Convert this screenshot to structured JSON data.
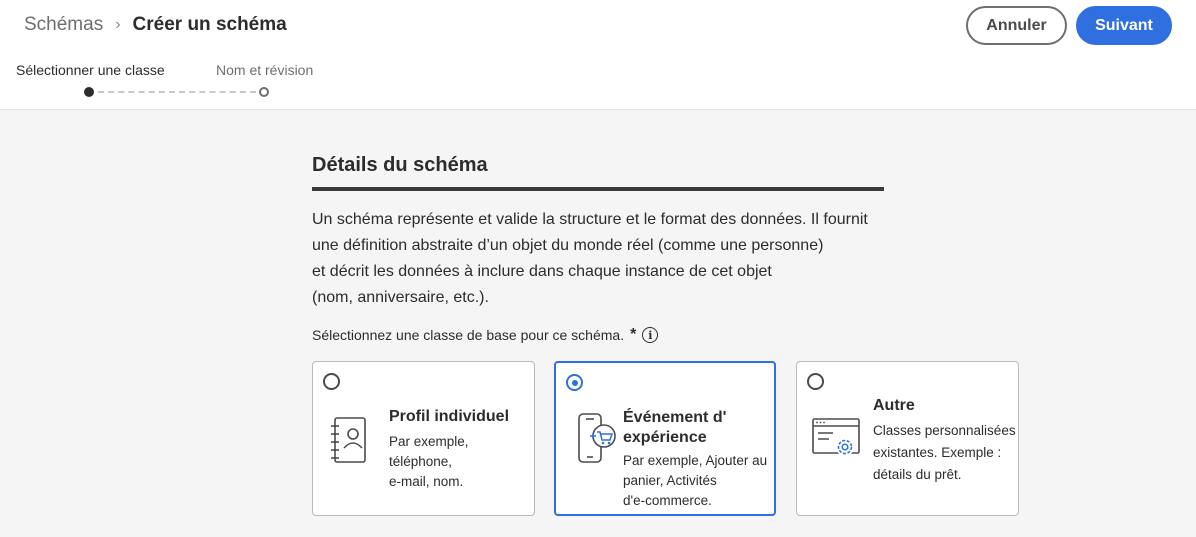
{
  "breadcrumb": {
    "parent": "Schémas",
    "separator": "›",
    "current": "Créer un schéma"
  },
  "actions": {
    "cancel_label": "Annuler",
    "next_label": "Suivant"
  },
  "steps": [
    {
      "label": "Sélectionner une classe",
      "state": "active"
    },
    {
      "label": "Nom et révision",
      "state": "pending"
    }
  ],
  "section": {
    "title": "Détails du schéma",
    "description_lines": [
      "Un schéma représente et valide la structure et le format des données. Il fournit",
      "une définition abstraite d’un objet du monde  réel (comme une personne)",
      "et décrit les données à inclure dans chaque instance de cet objet",
      "(nom, anniversaire, etc.)."
    ],
    "class_prompt": "Sélectionnez une classe de base pour ce schéma.",
    "required_marker": "*",
    "info_symbol": "i"
  },
  "classes": [
    {
      "title_lines": [
        "Profil individuel"
      ],
      "desc_lines": [
        "Par exemple,",
        "téléphone,",
        "e-mail, nom."
      ],
      "icon": "contact-book-icon",
      "selected": false
    },
    {
      "title_lines": [
        "Événement d'",
        "expérience"
      ],
      "desc_lines": [
        "Par exemple, Ajouter au",
        "panier, Activités",
        "d'e-commerce."
      ],
      "icon": "mobile-cart-icon",
      "selected": true
    },
    {
      "title_lines": [
        "Autre"
      ],
      "desc_lines": [
        "Classes personnalisées",
        "existantes. Exemple :",
        "détails du prêt."
      ],
      "icon": "window-gear-icon",
      "selected": false
    }
  ],
  "colors": {
    "accent": "#2f6fe0",
    "text": "#2c2c2c",
    "muted": "#6e6e6e",
    "background": "#f5f5f5"
  }
}
